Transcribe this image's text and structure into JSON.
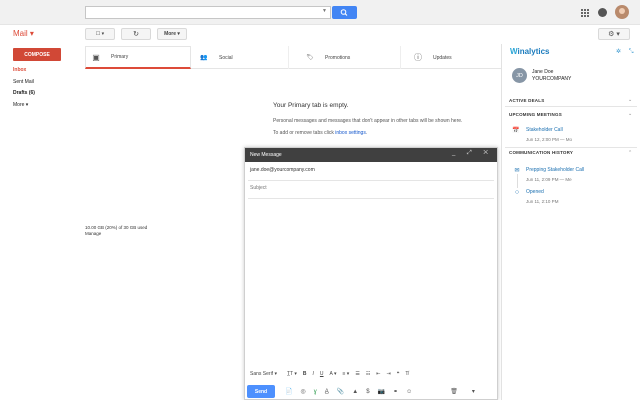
{
  "topbar": {
    "search_value": "",
    "search_dropdown_icon": "caret-down-icon",
    "search_button_icon": "magnifier-icon",
    "apps_icon": "apps-grid-icon",
    "notifications_icon": "notifications-icon",
    "avatar_icon": "profile-photo"
  },
  "mail": {
    "title": "Mail ▾",
    "more_label": "More ▾",
    "refresh_icon": "↻",
    "select_label": "☐ ▾",
    "settings_label": "⚙ ▾"
  },
  "nav": {
    "compose_label": "COMPOSE",
    "items": [
      {
        "label": "Inbox"
      },
      {
        "label": "Sent Mail"
      },
      {
        "label": "Drafts (6)"
      },
      {
        "label": "More ▾"
      }
    ]
  },
  "tabs": [
    {
      "label": "Primary",
      "icon": "▣"
    },
    {
      "label": "Social",
      "icon": "👥"
    },
    {
      "label": "Promotions",
      "icon": "🏷"
    },
    {
      "label": "Updates",
      "icon": "ⓘ"
    }
  ],
  "empty": {
    "title": "Your Primary tab is empty.",
    "subtitle": "Personal messages and messages that don't appear in other tabs will be shown here.",
    "hint_prefix": "To add or remove tabs click ",
    "hint_link": "inbox settings",
    "hint_suffix": "."
  },
  "storage": {
    "usage": "10.00 GB (20%) of 30 GB used",
    "manage": "Manage"
  },
  "compose": {
    "header": "New Message",
    "controls": "_ ⤢ ✕",
    "to": "jane.doe@yourcompany.com",
    "subject_placeholder": "Subject",
    "format_font": "Sans Serif ▾",
    "format_tools": [
      "T̲T ▾",
      "B",
      "I",
      "U",
      "A ▾",
      "≡ ▾",
      "☰",
      "☷",
      "⇤",
      "⇥",
      "❝",
      "T̸"
    ],
    "send_label": "Send",
    "bottom_tools": [
      "📄",
      "◎",
      "ɣ",
      "A̲",
      "📎",
      "▲",
      "$",
      "📷",
      "⚭",
      "☺"
    ],
    "trash_icon": "🗑",
    "more_icon": "▾"
  },
  "panel": {
    "logo_w": "W",
    "logo_rest": "inalytics",
    "icons": "✲ ⤡",
    "contact": {
      "initials": "JD",
      "name": "Jane Doe",
      "company": "YOURCOMPANY"
    },
    "sections": [
      {
        "label": "ACTIVE DEALS",
        "chevron": "⌄"
      },
      {
        "label": "UPCOMING MEETINGS",
        "chevron": "⌄"
      },
      {
        "label": "COMMUNICATION HISTORY",
        "chevron": "⌃"
      }
    ],
    "meeting": {
      "icon": "📅",
      "title": "Stakeholder Call",
      "sub": "Jun 12, 2:00 PM — Mo"
    },
    "history": [
      {
        "icon": "✉",
        "title": "Prepping Stakeholder Call",
        "sub": "Jun 11, 2:09 PM — Me"
      },
      {
        "icon": "○",
        "title": "Opened",
        "sub": "Jun 11, 2:10 PM"
      }
    ],
    "accent_color": "#1a6fb0"
  }
}
